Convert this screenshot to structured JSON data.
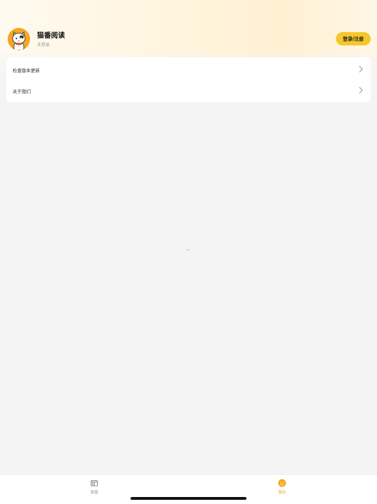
{
  "header": {
    "app_name": "猫番阅读",
    "login_status": "未登录",
    "login_button": "登录/注册",
    "avatar_icon": "cat-mascot-icon"
  },
  "menu": {
    "items": [
      {
        "label": "检查版本更新",
        "icon": "chevron-right-icon"
      },
      {
        "label": "关于我们",
        "icon": "chevron-right-icon"
      }
    ]
  },
  "tabbar": {
    "tabs": [
      {
        "label": "发现",
        "icon": "discover-icon",
        "active": false
      },
      {
        "label": "我的",
        "icon": "profile-icon",
        "active": true
      }
    ],
    "active_color": "#f0a81c",
    "inactive_color": "#888888"
  },
  "colors": {
    "accent": "#f7c72a",
    "background": "#f4f4f4"
  }
}
